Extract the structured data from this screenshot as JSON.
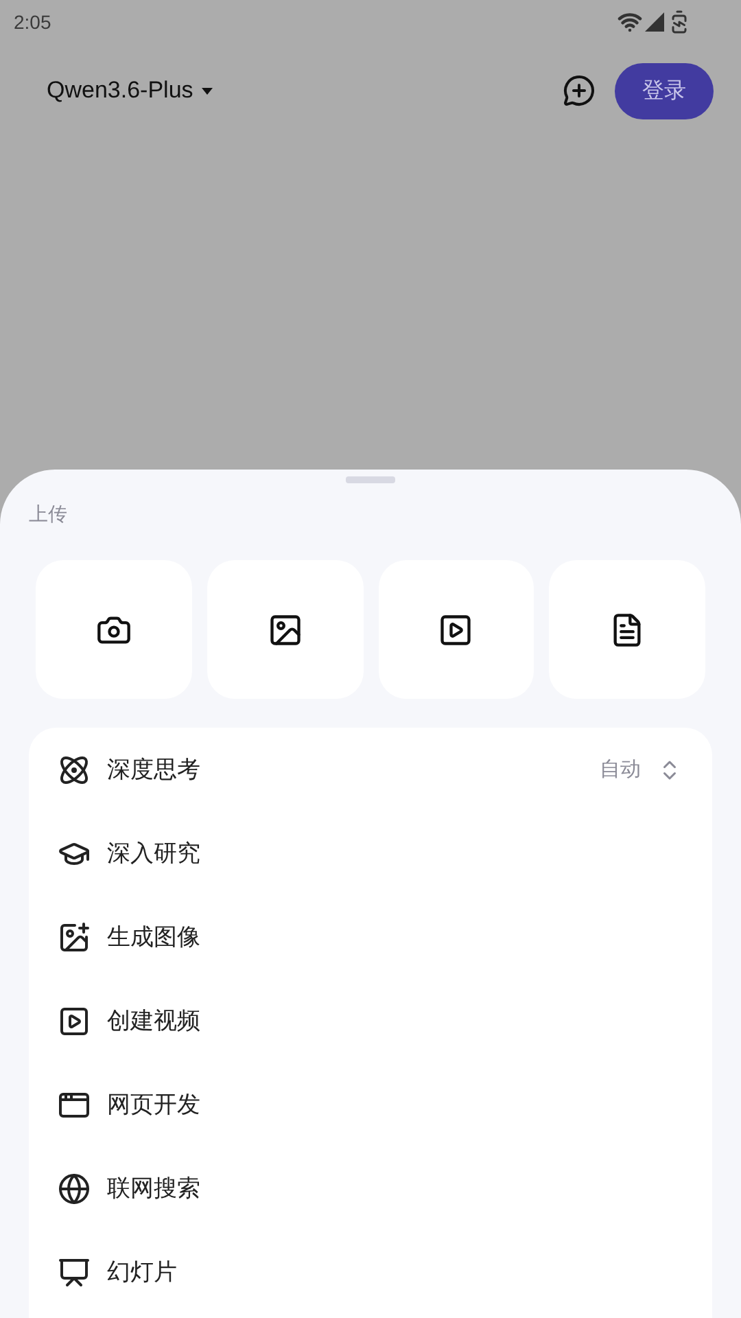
{
  "status_bar": {
    "time": "2:05"
  },
  "header": {
    "model": "Qwen3.6-Plus",
    "login_button": "登录"
  },
  "sheet": {
    "section_title": "上传",
    "menu": [
      {
        "label": "深度思考",
        "value": "自动"
      },
      {
        "label": "深入研究"
      },
      {
        "label": "生成图像"
      },
      {
        "label": "创建视频"
      },
      {
        "label": "网页开发"
      },
      {
        "label": "联网搜索"
      },
      {
        "label": "幻灯片"
      }
    ]
  }
}
